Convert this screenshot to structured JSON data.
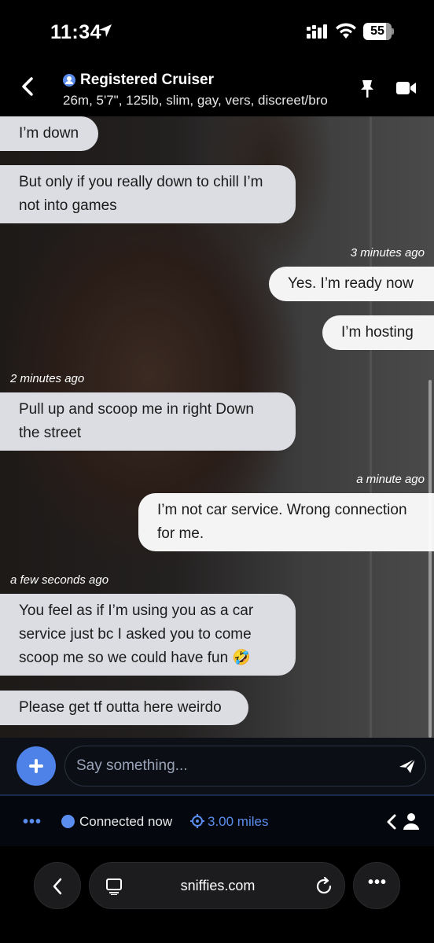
{
  "status_bar": {
    "time": "11:34",
    "battery": "55"
  },
  "header": {
    "name": "Registered Cruiser",
    "details": "26m, 5'7\", 125lb, slim, gay, vers, discreet/bro"
  },
  "messages": [
    {
      "type": "in",
      "text": "I’m down"
    },
    {
      "type": "in",
      "text": "But only if you really down to chill I’m not into games"
    },
    {
      "type": "timestamp",
      "text": "3 minutes ago"
    },
    {
      "type": "out",
      "text": "Yes. I’m ready now"
    },
    {
      "type": "out",
      "text": "I’m hosting"
    },
    {
      "type": "timestamp",
      "text": "2 minutes ago"
    },
    {
      "type": "in",
      "text": "Pull up and scoop me in right Down the street"
    },
    {
      "type": "timestamp",
      "text": "a minute ago"
    },
    {
      "type": "out",
      "text": "I’m not car service. Wrong connection for me."
    },
    {
      "type": "timestamp",
      "text": "a few seconds ago"
    },
    {
      "type": "in",
      "text": "You feel as if I’m using you as a car service just bc I asked you to come scoop me so we could have fun 🤣"
    },
    {
      "type": "in",
      "text": "Please get tf outta here weirdo"
    }
  ],
  "composer": {
    "placeholder": "Say something..."
  },
  "footer": {
    "more": "•••",
    "connection_status": "Connected now",
    "distance": "3.00 miles"
  },
  "browser": {
    "url": "sniffies.com",
    "more": "•••"
  },
  "colors": {
    "accent": "#5b8def",
    "incoming_bubble": "#dcdde3",
    "outgoing_bubble": "#f4f4f4"
  },
  "icons": [
    "location-arrow-icon",
    "signal-icon",
    "wifi-icon",
    "back-chevron-icon",
    "profile-icon",
    "pin-icon",
    "video-call-icon",
    "plus-icon",
    "send-icon",
    "target-icon",
    "chevron-left-icon",
    "person-icon",
    "tabs-icon",
    "reload-icon"
  ]
}
